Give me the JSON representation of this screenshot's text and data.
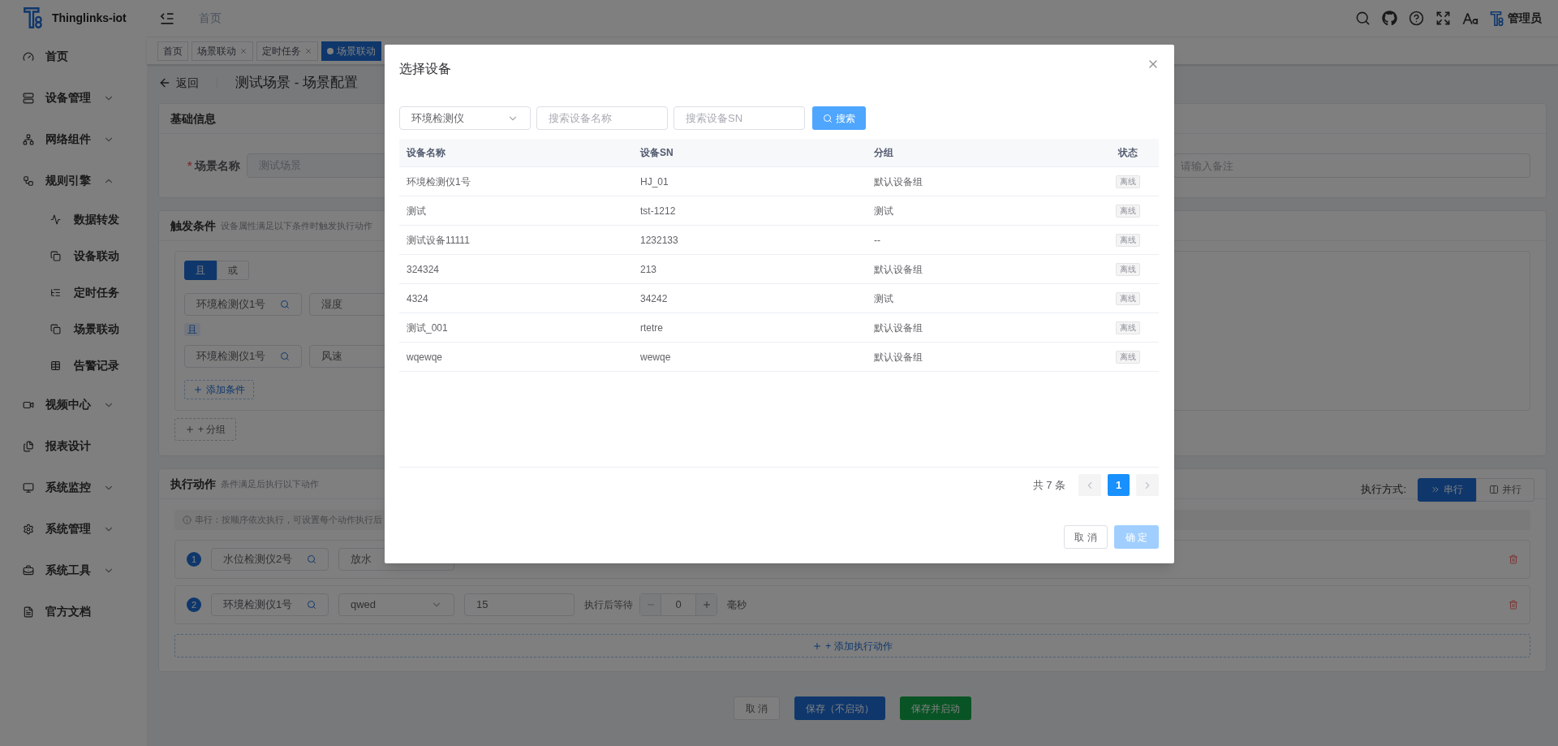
{
  "sidebar": {
    "brand": "Thinglinks-iot",
    "items": [
      {
        "label": "首页",
        "kind": "link"
      },
      {
        "label": "设备管理",
        "kind": "group",
        "expanded": false
      },
      {
        "label": "网络组件",
        "kind": "group",
        "expanded": false
      },
      {
        "label": "规则引擎",
        "kind": "group",
        "expanded": true,
        "children": [
          {
            "label": "数据转发"
          },
          {
            "label": "设备联动"
          },
          {
            "label": "定时任务"
          },
          {
            "label": "场景联动"
          },
          {
            "label": "告警记录"
          }
        ]
      },
      {
        "label": "视频中心",
        "kind": "group",
        "expanded": false
      },
      {
        "label": "报表设计",
        "kind": "link"
      },
      {
        "label": "系统监控",
        "kind": "group",
        "expanded": false
      },
      {
        "label": "系统管理",
        "kind": "group",
        "expanded": false
      },
      {
        "label": "系统工具",
        "kind": "group",
        "expanded": false
      },
      {
        "label": "官方文档",
        "kind": "link"
      }
    ]
  },
  "header": {
    "breadcrumb": "首页",
    "user": "管理员"
  },
  "tags": [
    {
      "label": "首页",
      "closable": false,
      "selected": false
    },
    {
      "label": "场景联动",
      "closable": true,
      "selected": false
    },
    {
      "label": "定时任务",
      "closable": true,
      "selected": false
    },
    {
      "label": "场景联动",
      "closable": false,
      "selected": true
    }
  ],
  "page": {
    "back": "返回",
    "title": "测试场景 - 场景配置"
  },
  "basic_info": {
    "title": "基础信息",
    "name_label": "场景名称",
    "required_mark": "*",
    "name_value": "测试场景",
    "name_disabled": true,
    "remark_placeholder": "请输入备注"
  },
  "trigger": {
    "title": "触发条件",
    "subtitle": "设备属性满足以下条件时触发执行动作",
    "logic": [
      {
        "label": "且",
        "selected": true
      },
      {
        "label": "或",
        "selected": false
      }
    ],
    "conditions": [
      {
        "device": "环境检测仪1号",
        "property": "湿度"
      },
      {
        "device": "环境检测仪1号",
        "property": "风速"
      }
    ],
    "joiner": "且",
    "add_condition": "添加条件",
    "add_group": "+ 分组"
  },
  "actions": {
    "title": "执行动作",
    "subtitle": "条件满足后执行以下动作",
    "mode_label": "执行方式:",
    "modes": [
      {
        "label": "串行",
        "selected": true
      },
      {
        "label": "并行",
        "selected": false
      }
    ],
    "info": "串行：按顺序依次执行，可设置每个动作执行后",
    "steps": [
      {
        "index": "1",
        "device": "水位检测仪2号",
        "action": "放水"
      },
      {
        "index": "2",
        "device": "环境检测仪1号",
        "action": "qwed",
        "value": "15",
        "wait_label": "执行后等待",
        "wait": "0",
        "unit": "毫秒"
      }
    ],
    "add_action": "+ 添加执行动作"
  },
  "footer": {
    "cancel": "取 消",
    "save": "保存（不启动）",
    "save_start": "保存并启动"
  },
  "dialog": {
    "title": "选择设备",
    "product": "环境检测仪",
    "name_placeholder": "搜索设备名称",
    "sn_placeholder": "搜索设备SN",
    "search": "搜索",
    "columns": [
      "设备名称",
      "设备SN",
      "分组",
      "状态"
    ],
    "rows": [
      {
        "name": "环境检测仪1号",
        "sn": "HJ_01",
        "group": "默认设备组",
        "status": "离线"
      },
      {
        "name": "测试",
        "sn": "tst-1212",
        "group": "测试",
        "status": "离线"
      },
      {
        "name": "测试设备11111",
        "sn": "1232133",
        "group": "--",
        "status": "离线"
      },
      {
        "name": "324324",
        "sn": "213",
        "group": "默认设备组",
        "status": "离线"
      },
      {
        "name": "4324",
        "sn": "34242",
        "group": "测试",
        "status": "离线"
      },
      {
        "name": "测试_001",
        "sn": "rtetre",
        "group": "默认设备组",
        "status": "离线"
      },
      {
        "name": "wqewqe",
        "sn": "wewqe",
        "group": "默认设备组",
        "status": "离线"
      }
    ],
    "total": "共 7 条",
    "pages": [
      {
        "label": "1",
        "selected": true
      }
    ],
    "cancel": "取 消",
    "confirm": "确 定",
    "confirm_disabled": true
  }
}
